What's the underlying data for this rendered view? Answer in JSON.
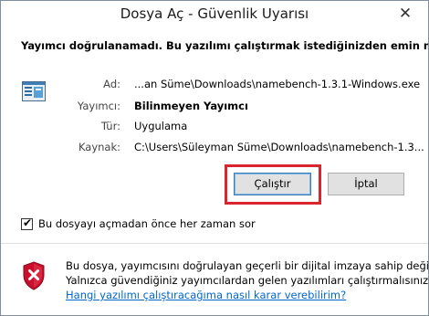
{
  "window": {
    "title": "Dosya Aç - Güvenlik Uyarısı",
    "close_glyph": "✕"
  },
  "question": "Yayımcı doğrulanamadı. Bu yazılımı çalıştırmak istediğinizden emin misiniz?",
  "details": {
    "name_label": "Ad:",
    "name_value": "...an Süme\\Downloads\\namebench-1.3.1-Windows.exe",
    "publisher_label": "Yayımcı:",
    "publisher_value": "Bilinmeyen Yayımcı",
    "type_label": "Tür:",
    "type_value": "Uygulama",
    "source_label": "Kaynak:",
    "source_value": "C:\\Users\\Süleyman Süme\\Downloads\\namebench-1.3..."
  },
  "buttons": {
    "run_label": "Çalıştır",
    "cancel_label": "İptal"
  },
  "checkbox": {
    "checked": true,
    "check_glyph": "✔",
    "label": "Bu dosyayı açmadan önce her zaman sor"
  },
  "footer": {
    "line1": "Bu dosya, yayımcısını doğrulayan geçerli bir dijital imzaya sahip değil.",
    "line2": "Yalnızca güvendiğiniz yayımcılardan gelen yazılımları çalıştırmalısınız.",
    "link": "Hangi yazılımı çalıştıracağıma nasıl karar verebilirim?"
  },
  "colors": {
    "highlight_border": "#d9262e",
    "link": "#0066cc",
    "shield_red": "#c8102e"
  },
  "icons": {
    "file": "executable-file-icon",
    "shield": "security-shield-warning-icon",
    "close": "close-icon"
  }
}
